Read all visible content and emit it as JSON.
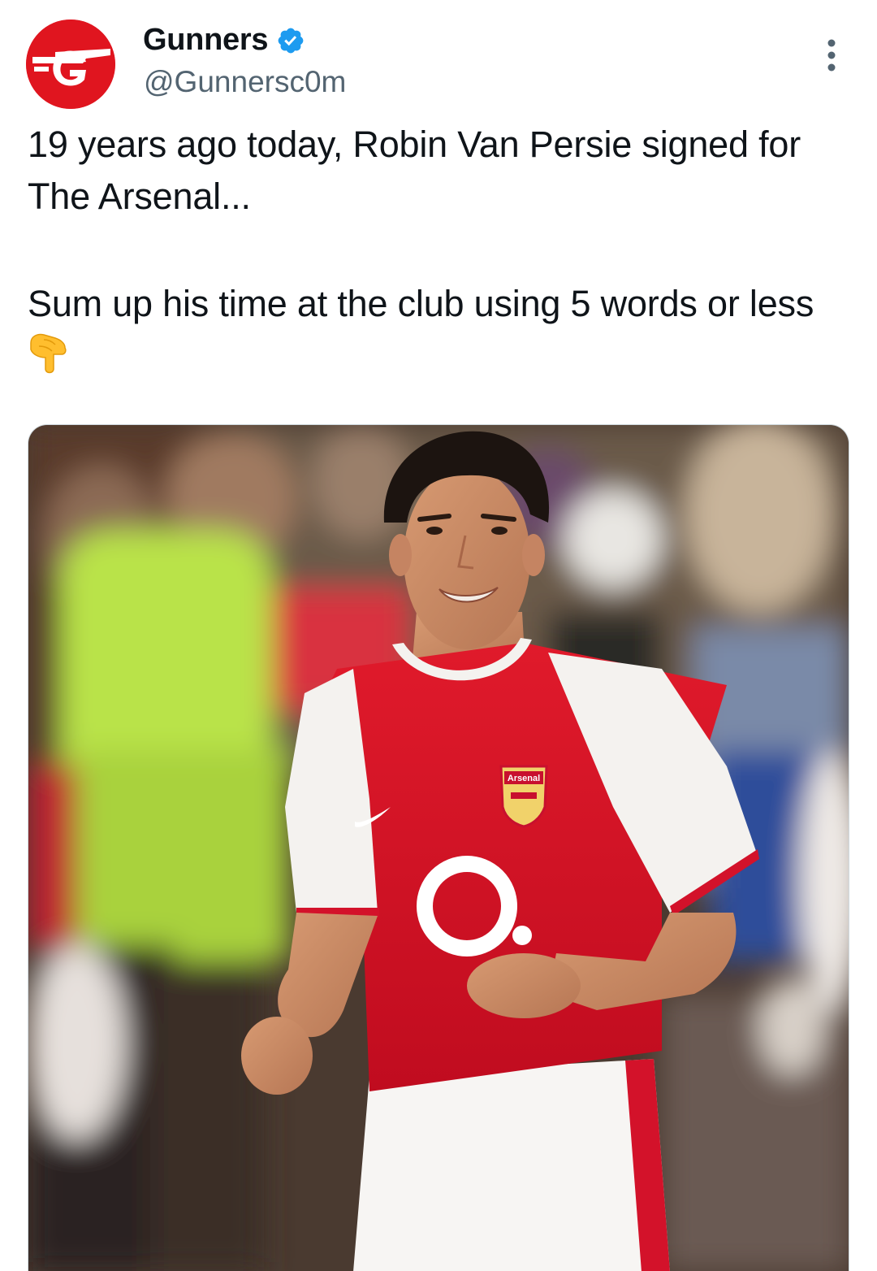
{
  "tweet": {
    "author": {
      "display_name": "Gunners",
      "handle": "@Gunnersc0m",
      "verified": true,
      "avatar_icon": "gunners-logo-icon",
      "avatar_color": "#e0151f"
    },
    "text_lines": [
      "19 years ago today, Robin Van Persie signed for The Arsenal...",
      "Sum up his time at the club using 5 words or less"
    ],
    "emoji_icon": "backhand-index-pointing-down-icon",
    "media": {
      "kind": "photo",
      "shirt_badge_text": "Arsenal",
      "shirt_sponsor_text": "O2"
    },
    "colors": {
      "verified_blue": "#1d9bf0",
      "secondary_text": "#536471",
      "arsenal_red": "#d9102a"
    }
  }
}
